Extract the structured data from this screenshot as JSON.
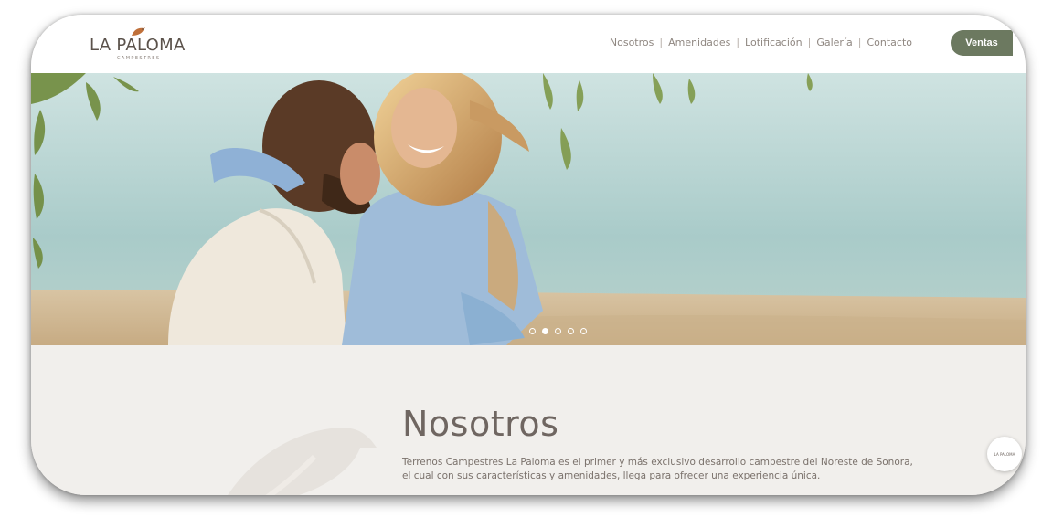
{
  "brand": {
    "name": "LA PALOMA",
    "tagline": "CAMPESTRES",
    "accent": "#c0703a"
  },
  "nav": {
    "items": [
      {
        "label": "Nosotros"
      },
      {
        "label": "Amenidades"
      },
      {
        "label": "Lotificación"
      },
      {
        "label": "Galería"
      },
      {
        "label": "Contacto"
      }
    ],
    "separator": "|",
    "cta_label": "Ventas",
    "cta_color": "#6c7960"
  },
  "hero": {
    "image": "couple-at-lake-photo",
    "slides": 5,
    "active_slide": 2
  },
  "about": {
    "title": "Nosotros",
    "body": "Terrenos Campestres La Paloma es el primer y más exclusivo desarrollo campestre del Noreste de Sonora, el cual con sus características y amenidades, llega para ofrecer una experiencia única."
  },
  "floating_badge": {
    "label": "LA PALOMA"
  }
}
